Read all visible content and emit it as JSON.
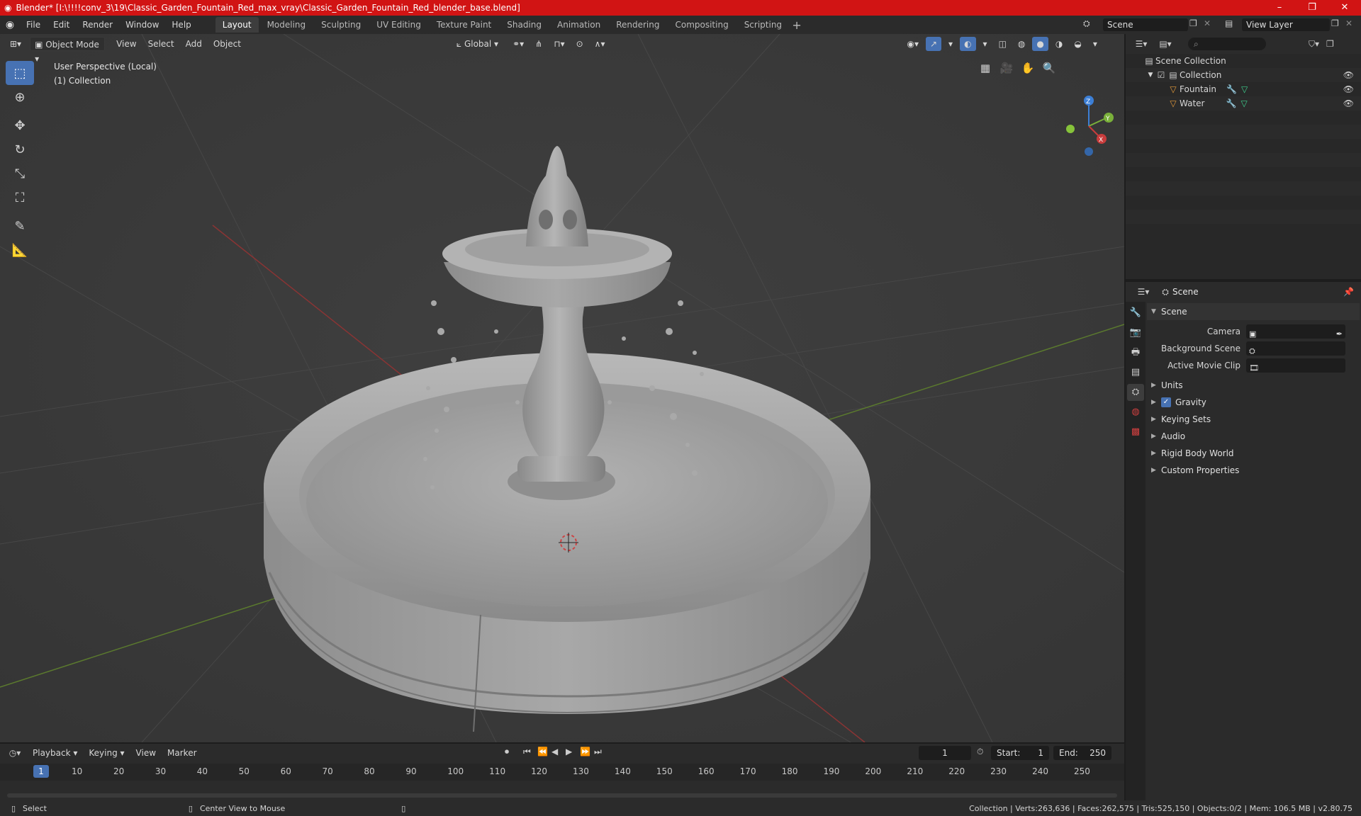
{
  "title": "Blender* [I:\\!!!!conv_3\\19\\Classic_Garden_Fountain_Red_max_vray\\Classic_Garden_Fountain_Red_blender_base.blend]",
  "window_controls": [
    "–",
    "❐",
    "✕"
  ],
  "menu": [
    "File",
    "Edit",
    "Render",
    "Window",
    "Help"
  ],
  "workspaces": [
    "Layout",
    "Modeling",
    "Sculpting",
    "UV Editing",
    "Texture Paint",
    "Shading",
    "Animation",
    "Rendering",
    "Compositing",
    "Scripting"
  ],
  "active_workspace": "Layout",
  "scene_name": "Scene",
  "view_layer": "View Layer",
  "viewport_header": {
    "mode": "Object Mode",
    "items": [
      "View",
      "Select",
      "Add",
      "Object"
    ],
    "transform": "Global"
  },
  "viewport": {
    "perspective": "User Perspective (Local)",
    "collection": "(1) Collection"
  },
  "gizmo": {
    "z": "Z",
    "y": "Y",
    "x": "X"
  },
  "outliner": {
    "root": "Scene Collection",
    "collection": "Collection",
    "objects": [
      "Fountain",
      "Water"
    ]
  },
  "properties": {
    "header": "Scene",
    "section": "Scene",
    "fields": [
      {
        "label": "Camera"
      },
      {
        "label": "Background Scene"
      },
      {
        "label": "Active Movie Clip"
      }
    ],
    "panels": [
      "Units",
      "Gravity",
      "Keying Sets",
      "Audio",
      "Rigid Body World",
      "Custom Properties"
    ],
    "gravity_checked": true
  },
  "timeline": {
    "menus": [
      "Playback",
      "Keying",
      "View",
      "Marker"
    ],
    "current_frame": "1",
    "start_label": "Start:",
    "start": "1",
    "end_label": "End:",
    "end": "250",
    "ticks": [
      "1",
      "10",
      "20",
      "30",
      "40",
      "50",
      "60",
      "70",
      "80",
      "90",
      "100",
      "110",
      "120",
      "130",
      "140",
      "150",
      "160",
      "170",
      "180",
      "190",
      "200",
      "210",
      "220",
      "230",
      "240",
      "250"
    ]
  },
  "statusbar": {
    "left": "Select",
    "middle": "Center View to Mouse",
    "right": "Collection | Verts:263,636 | Faces:262,575 | Tris:525,150 | Objects:0/2 | Mem: 106.5 MB | v2.80.75"
  },
  "colors": {
    "titlebar": "#d11414",
    "accent": "#4772b3",
    "viewport_bg": "#3b3b3b",
    "axis_x": "#c83c3c",
    "axis_y": "#7ab03a",
    "axis_z": "#3c7fd6"
  }
}
